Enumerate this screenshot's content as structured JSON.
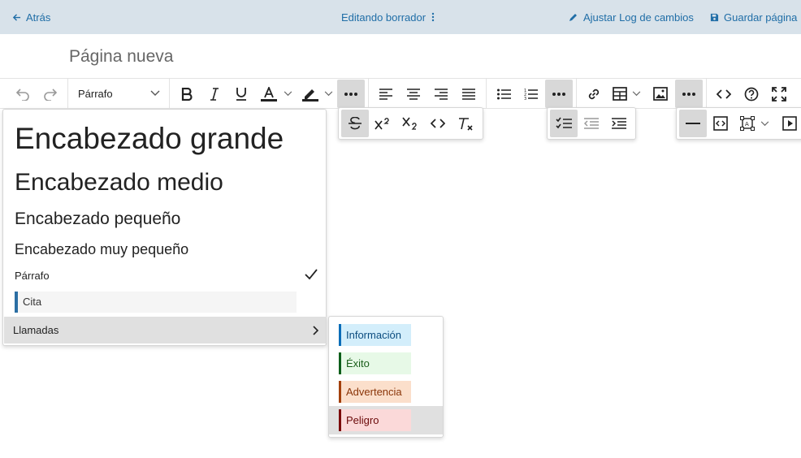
{
  "header": {
    "back_label": "Atrás",
    "status_label": "Editando borrador",
    "changelog_label": "Ajustar Log de cambios",
    "save_label": "Guardar página"
  },
  "page": {
    "title": "Página nueva"
  },
  "toolbar": {
    "block_format_value": "Párrafo",
    "buttons": [
      "undo-icon",
      "redo-icon",
      "bold-icon",
      "italic-icon",
      "underline-icon",
      "text-color-icon",
      "highlight-icon",
      "more-icon",
      "align-left-icon",
      "align-center-icon",
      "align-right-icon",
      "justify-icon",
      "bullet-list-icon",
      "numbered-list-icon",
      "more-icon",
      "link-icon",
      "table-icon",
      "image-icon",
      "more-icon",
      "code-icon",
      "help-icon",
      "fullscreen-icon"
    ]
  },
  "format_menu": {
    "heading_large": "Encabezado grande",
    "heading_medium": "Encabezado medio",
    "heading_small": "Encabezado pequeño",
    "heading_tiny": "Encabezado muy pequeño",
    "paragraph": "Párrafo",
    "quote": "Cita",
    "callouts": "Llamadas",
    "selected": "Párrafo"
  },
  "callouts_menu": {
    "items": [
      {
        "label": "Información",
        "bg": "#d3eefb",
        "bar": "#0b6db8",
        "color": "#0c4d80"
      },
      {
        "label": "Éxito",
        "bg": "#e7f9e7",
        "bar": "#0c5e1a",
        "color": "#1a5e1a"
      },
      {
        "label": "Advertencia",
        "bg": "#fbdfcb",
        "bar": "#a3400c",
        "color": "#8a3508"
      },
      {
        "label": "Peligro",
        "bg": "#fbd9d9",
        "bar": "#7c0a0a",
        "color": "#6b0a0a"
      }
    ],
    "hovered": "Peligro"
  },
  "colors": {
    "header_bg": "#d8e2ea",
    "link": "#206ea7",
    "active_btn": "#d8d8d8"
  }
}
